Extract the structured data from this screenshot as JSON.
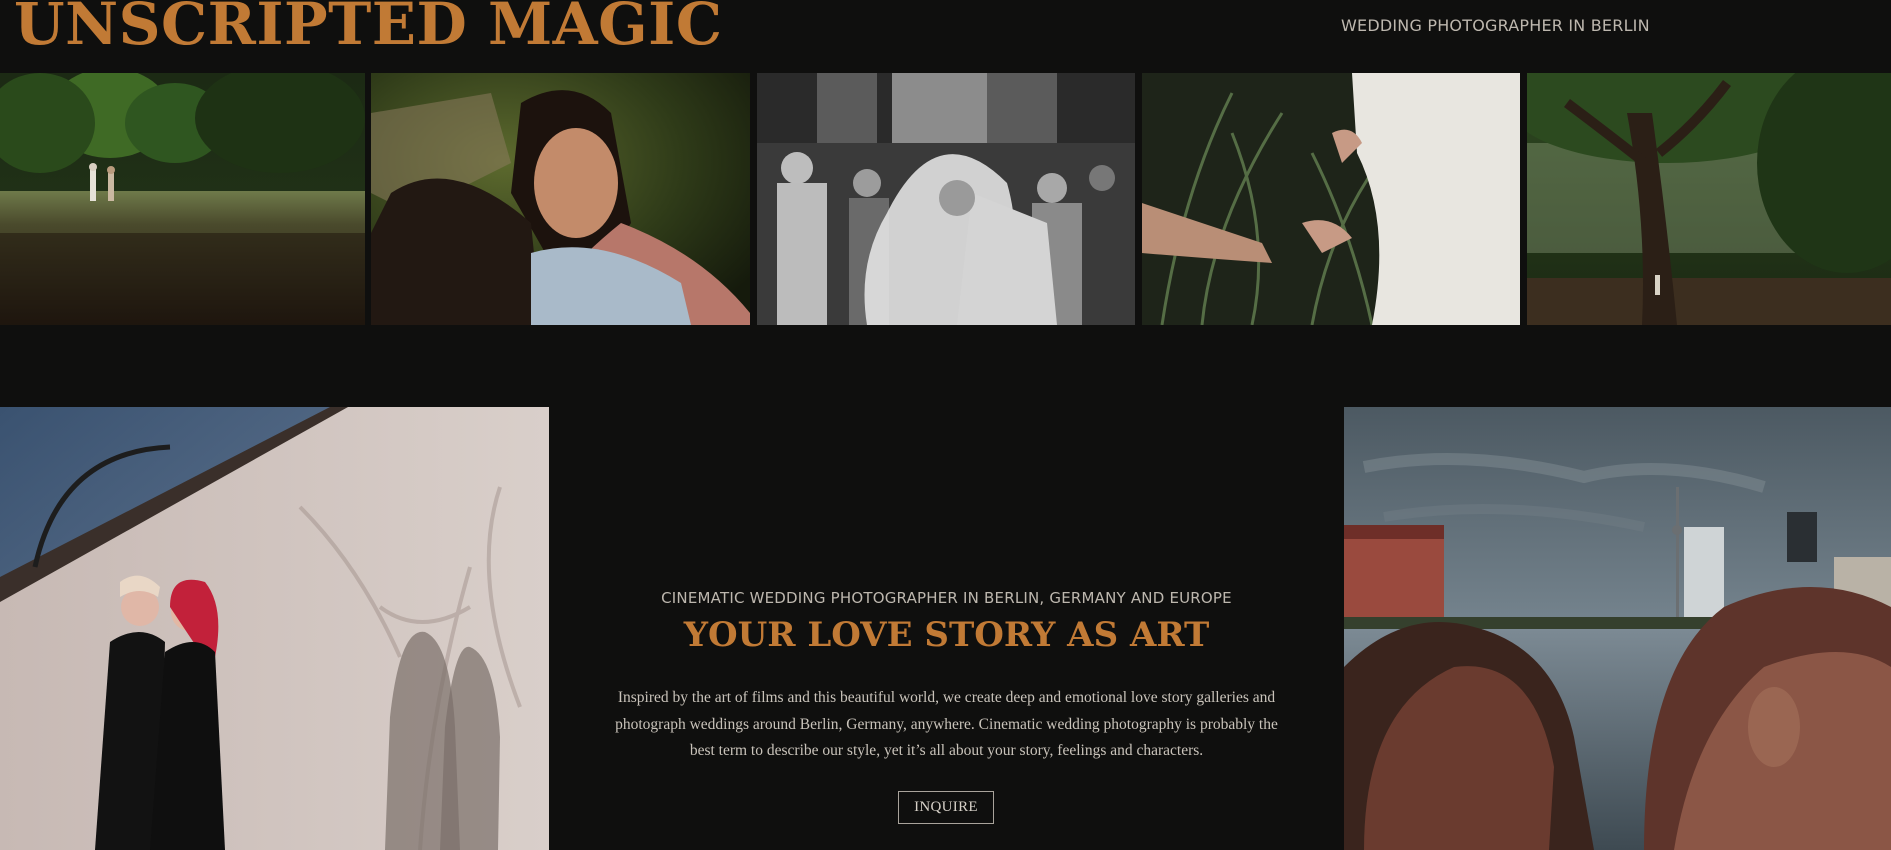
{
  "header": {
    "logo_text": "UNSCRIPTED MAGIC",
    "tagline": "WEDDING PHOTOGRAPHER IN BERLIN"
  },
  "intro": {
    "eyebrow": "CINEMATIC WEDDING PHOTOGRAPHER IN BERLIN, GERMANY AND EUROPE",
    "headline": "YOUR LOVE STORY AS ART",
    "body": "Inspired by the art of films and this beautiful world, we create deep and emotional love story galleries and photograph weddings around Berlin, Germany, anywhere. Cinematic wedding photography is probably the best term to describe our style, yet it’s all about your story, feelings and characters.",
    "cta_label": "INQUIRE"
  },
  "colors": {
    "background": "#0f0f0e",
    "accent": "#c17a35",
    "muted_text": "#bdb7ae"
  }
}
